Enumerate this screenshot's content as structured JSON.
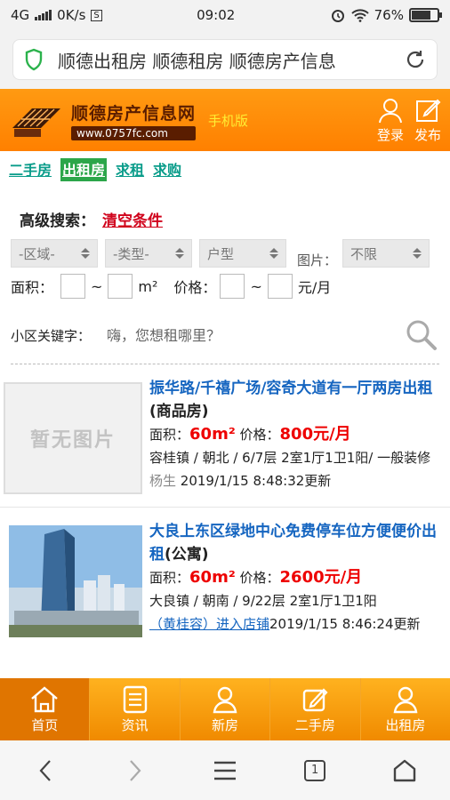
{
  "status_bar": {
    "network": "4G",
    "speed": "0K/s",
    "s_badge": "S",
    "time": "09:02",
    "battery": "76%",
    "battery_level": 0.76
  },
  "browser": {
    "url_title": "顺德出租房 顺德租房 顺德房产信息"
  },
  "site_header": {
    "logo_name": "顺德房产信息网",
    "logo_url": "www.0757fc.com",
    "mobile_tag": "手机版",
    "login_label": "登录",
    "post_label": "发布"
  },
  "category_tabs": [
    {
      "label": "二手房",
      "active": false
    },
    {
      "label": "出租房",
      "active": true
    },
    {
      "label": "求租",
      "active": false
    },
    {
      "label": "求购",
      "active": false
    }
  ],
  "search": {
    "advanced_label": "高级搜索：",
    "clear_label": "清空条件",
    "district_select": "-区域-",
    "type_select": "-类型-",
    "layout_select": "户型",
    "picture_label": "图片：",
    "picture_select": "不限",
    "area_label": "面积：",
    "tilde": "~",
    "area_unit": "m²",
    "price_label": "价格：",
    "price_unit": "元/月",
    "keyword_label": "小区关键字：",
    "keyword_placeholder": "嗨，您想租哪里？"
  },
  "listings": [
    {
      "no_image_text": "暂无图片",
      "title_link": "振华路/千禧广场/容奇大道有一厅两房出租",
      "type": "(商品房)",
      "area_label": "面积：",
      "area": "60m²",
      "price_label": "价格：",
      "price": "800元/月",
      "details": "容桂镇 / 朝北 / 6/7层 2室1厅1卫1阳/ 一般装修",
      "agent": "杨生",
      "updated": "2019/1/15 8:48:32更新"
    },
    {
      "title_link": "大良上东区绿地中心免费停车位方便便价出租",
      "type": "(公寓)",
      "area_label": "面积：",
      "area": "60m²",
      "price_label": "价格：",
      "price": "2600元/月",
      "details": "大良镇 / 朝南 / 9/22层 2室1厅1卫1阳",
      "shop_link": "（黄桂容）进入店铺",
      "updated": "2019/1/15 8:46:24更新"
    }
  ],
  "bottom_nav": [
    {
      "label": "首页",
      "icon": "home-icon"
    },
    {
      "label": "资讯",
      "icon": "news-icon"
    },
    {
      "label": "新房",
      "icon": "person-icon"
    },
    {
      "label": "二手房",
      "icon": "edit-icon"
    },
    {
      "label": "出租房",
      "icon": "person-icon"
    }
  ],
  "system_nav": {
    "tab_count": "1"
  },
  "colors": {
    "header_orange": "#ff8c00",
    "tab_green": "#2ca64a",
    "price_red": "#e00000",
    "link_blue": "#1565c0"
  }
}
